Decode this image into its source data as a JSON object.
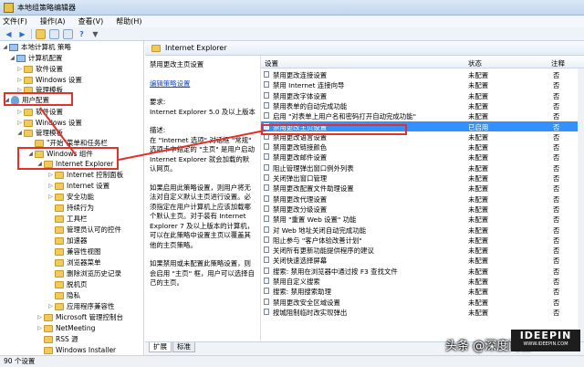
{
  "window": {
    "title": "本地组策略编辑器"
  },
  "menu": {
    "items": [
      "文件(F)",
      "操作(A)",
      "查看(V)",
      "帮助(H)"
    ]
  },
  "toolbar": {
    "icons": [
      "back-arrow-icon",
      "forward-arrow-icon",
      "up-folder-icon",
      "show-tree-icon",
      "properties-icon",
      "help-icon",
      "filter-icon"
    ]
  },
  "tree": {
    "items": [
      {
        "label": "本地计算机 策略",
        "depth": 0
      },
      {
        "label": "计算机配置",
        "depth": 1
      },
      {
        "label": "软件设置",
        "depth": 2
      },
      {
        "label": "Windows 设置",
        "depth": 2
      },
      {
        "label": "管理模板",
        "depth": 2
      },
      {
        "label": "用户配置",
        "depth": 1
      },
      {
        "label": "软件设置",
        "depth": 2
      },
      {
        "label": "Windows 设置",
        "depth": 2
      },
      {
        "label": "管理模板",
        "depth": 2
      },
      {
        "label": "\"开始\"菜单和任务栏",
        "depth": 3
      },
      {
        "label": "Windows 组件",
        "depth": 3
      },
      {
        "label": "Internet Explorer",
        "depth": 4
      },
      {
        "label": "Internet 控制面板",
        "depth": 5
      },
      {
        "label": "Internet 设置",
        "depth": 5
      },
      {
        "label": "安全功能",
        "depth": 5
      },
      {
        "label": "持续行为",
        "depth": 5
      },
      {
        "label": "工具栏",
        "depth": 5
      },
      {
        "label": "管理员认可的控件",
        "depth": 5
      },
      {
        "label": "加速器",
        "depth": 5
      },
      {
        "label": "兼容性视图",
        "depth": 5
      },
      {
        "label": "浏览器菜单",
        "depth": 5
      },
      {
        "label": "删除浏览历史记录",
        "depth": 5
      },
      {
        "label": "脱机页",
        "depth": 5
      },
      {
        "label": "隐私",
        "depth": 5
      },
      {
        "label": "应用程序兼容性",
        "depth": 5
      },
      {
        "label": "Microsoft 管理控制台",
        "depth": 4
      },
      {
        "label": "NetMeeting",
        "depth": 4
      },
      {
        "label": "RSS 源",
        "depth": 4
      },
      {
        "label": "Windows Installer",
        "depth": 4
      }
    ]
  },
  "panel": {
    "header": "Internet Explorer"
  },
  "description": {
    "title": "禁用更改主页设置",
    "edit_link": "编辑策略设置",
    "requirement_label": "要求:",
    "requirement": "Internet Explorer 5.0 及以上版本",
    "desc_label": "描述:",
    "desc": "在 \"Internet 选项\" 对话框 \"常规\" 选项卡中指定的 \"主页\" 是用户启动 Internet Explorer 就会加载的默认网页。",
    "enabled": "如果启用此策略设置，则用户将无法对自定义默认主页进行设置。必须指定在用户计算机上应该加载哪个默认主页。对于装有 Internet Explorer 7 及以上版本的计算机，可以在此策略中设置主页以覆盖其他的主页策略。",
    "disabled": "如果禁用或未配置此策略设置，则会启用 \"主页\" 框，用户可以选择自己的主页。"
  },
  "list": {
    "columns": [
      "设置",
      "状态",
      "注释"
    ],
    "rows": [
      {
        "name": "禁用更改连接设置",
        "state": "未配置",
        "note": "否"
      },
      {
        "name": "禁用 Internet 连接向导",
        "state": "未配置",
        "note": "否"
      },
      {
        "name": "禁用更改字体设置",
        "state": "未配置",
        "note": "否"
      },
      {
        "name": "禁用表单的自动完成功能",
        "state": "未配置",
        "note": "否"
      },
      {
        "name": "启用 \"对表单上用户名和密码打开自动完成功能\"",
        "state": "未配置",
        "note": "否"
      },
      {
        "name": "禁用更改主页设置",
        "state": "已启用",
        "note": "否",
        "selected": true
      },
      {
        "name": "禁用更改语言设置",
        "state": "未配置",
        "note": "否"
      },
      {
        "name": "禁用更改链接颜色",
        "state": "未配置",
        "note": "否"
      },
      {
        "name": "禁用更改邮件设置",
        "state": "未配置",
        "note": "否"
      },
      {
        "name": "阻止管理弹出窗口例外列表",
        "state": "未配置",
        "note": "否"
      },
      {
        "name": "关闭弹出窗口管理",
        "state": "未配置",
        "note": "否"
      },
      {
        "name": "禁用更改配置文件助理设置",
        "state": "未配置",
        "note": "否"
      },
      {
        "name": "禁用更改代理设置",
        "state": "未配置",
        "note": "否"
      },
      {
        "name": "禁用更改分级设置",
        "state": "未配置",
        "note": "否"
      },
      {
        "name": "禁用 \"重置 Web 设置\" 功能",
        "state": "未配置",
        "note": "否"
      },
      {
        "name": "对 Web 地址关闭自动完成功能",
        "state": "未配置",
        "note": "否"
      },
      {
        "name": "阻止参与 \"客户体验改善计划\"",
        "state": "未配置",
        "note": "否"
      },
      {
        "name": "关闭所有更新功能提供程序的建议",
        "state": "未配置",
        "note": "否"
      },
      {
        "name": "关闭快速选择屏幕",
        "state": "未配置",
        "note": "否"
      },
      {
        "name": "搜索: 禁用在浏览器中通过按 F3 查找文件",
        "state": "未配置",
        "note": "否"
      },
      {
        "name": "禁用自定义搜索",
        "state": "未配置",
        "note": "否"
      },
      {
        "name": "搜索: 禁用搜索助理",
        "state": "未配置",
        "note": "否"
      },
      {
        "name": "禁用更改安全区域设置",
        "state": "未配置",
        "note": "否"
      },
      {
        "name": "按城阻制临时改实现弹出",
        "state": "未配置",
        "note": "否"
      }
    ]
  },
  "tabs": {
    "extended": "扩展",
    "standard": "标准"
  },
  "status": {
    "text": "90 个设置"
  },
  "watermark": {
    "brand": "IDEEPIN",
    "brand_sub": "WWW.IDEEPIN.COM",
    "source": "头条 @深度问答"
  },
  "colors": {
    "selection": "#3390ff",
    "annotation": "#e0312a"
  }
}
